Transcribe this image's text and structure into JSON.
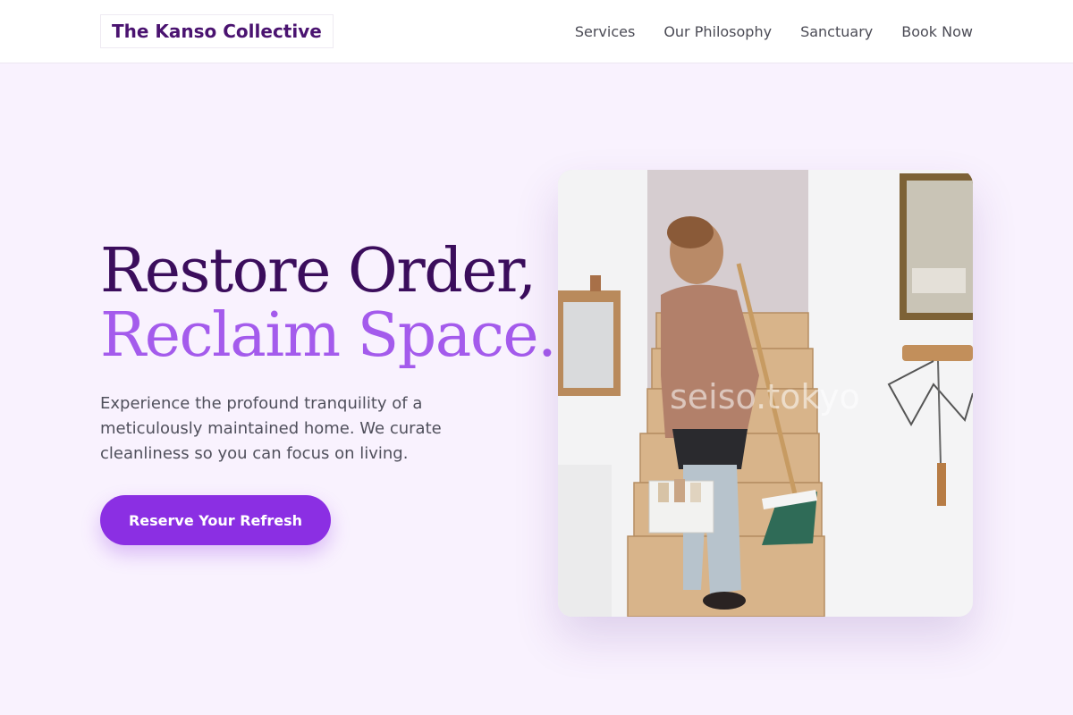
{
  "brand": {
    "name": "The Kanso Collective"
  },
  "nav": {
    "items": [
      {
        "label": "Services"
      },
      {
        "label": "Our Philosophy"
      },
      {
        "label": "Sanctuary"
      },
      {
        "label": "Book Now"
      }
    ]
  },
  "hero": {
    "headline_line1": "Restore Order,",
    "headline_line2": "Reclaim Space.",
    "subtext": "Experience the profound tranquility of a meticulously maintained home. We curate cleanliness so you can focus on living.",
    "cta_label": "Reserve Your Refresh",
    "image_watermark": "seiso.tokyo"
  },
  "colors": {
    "page_background": "#f9f2fe",
    "brand_dark": "#3b0d5c",
    "brand_light": "#a45bec",
    "cta": "#8b2fe3"
  }
}
